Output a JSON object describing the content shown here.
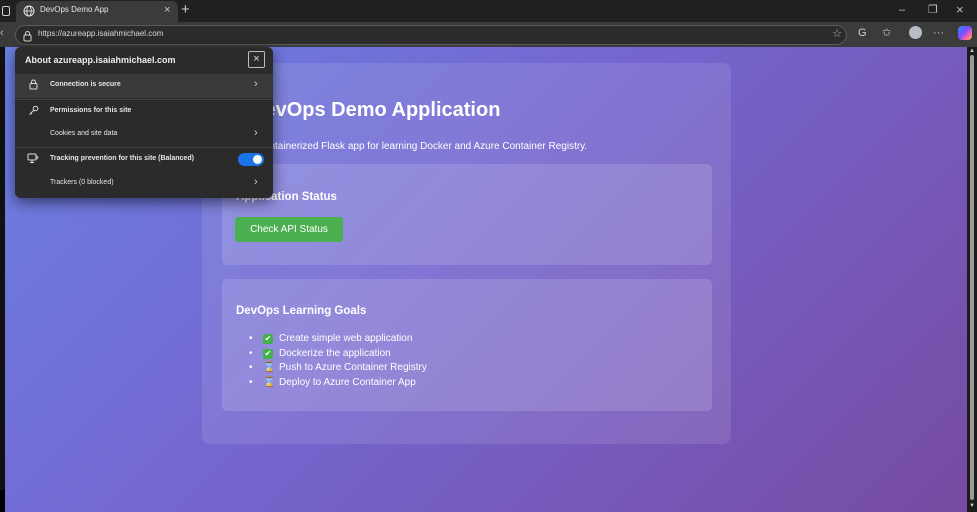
{
  "browser": {
    "tab_title": "DevOps Demo App",
    "tab_close": "×",
    "new_tab": "+",
    "window_controls": {
      "minimize": "–",
      "restore": "❐",
      "close": "×"
    },
    "url": "https://azureapp.isaiahmichael.com",
    "toolbar_icons": [
      "favorite-star-icon",
      "reading-g-icon",
      "favorites-list-icon",
      "profile-avatar-icon",
      "more-icon",
      "copilot-icon"
    ]
  },
  "site_info": {
    "title": "About azureapp.isaiahmichael.com",
    "close_glyph": "×",
    "rows": [
      {
        "label": "Connection is secure",
        "icon": "lock-icon",
        "chevron": "›"
      },
      {
        "label": "Permissions for this site",
        "icon": "key-icon"
      },
      {
        "label": "Cookies and site data",
        "chevron": "›"
      },
      {
        "label": "Tracking prevention for this site (Balanced)",
        "icon": "tracking-icon",
        "toggle": true
      },
      {
        "label": "Trackers (0 blocked)",
        "chevron": "›"
      }
    ]
  },
  "page": {
    "title": "DevOps Demo Application",
    "description": "A containerized Flask app for learning Docker and Azure Container Registry.",
    "status_section": {
      "title": "Application Status",
      "button_label": "Check API Status",
      "button_color": "#4caf50"
    },
    "goals_section": {
      "title": "DevOps Learning Goals",
      "items": [
        {
          "text": "Create simple web application",
          "status": "done",
          "icon": "✔"
        },
        {
          "text": "Dockerize the application",
          "status": "done",
          "icon": "✔"
        },
        {
          "text": "Push to Azure Container Registry",
          "status": "pending",
          "icon": "⌛"
        },
        {
          "text": "Deploy to Azure Container App",
          "status": "pending",
          "icon": "⌛"
        }
      ]
    }
  },
  "colors": {
    "background_start": "#667eea",
    "background_end": "#764ba2",
    "toggle_on": "#1a73e8",
    "done_check": "#43b04a"
  }
}
